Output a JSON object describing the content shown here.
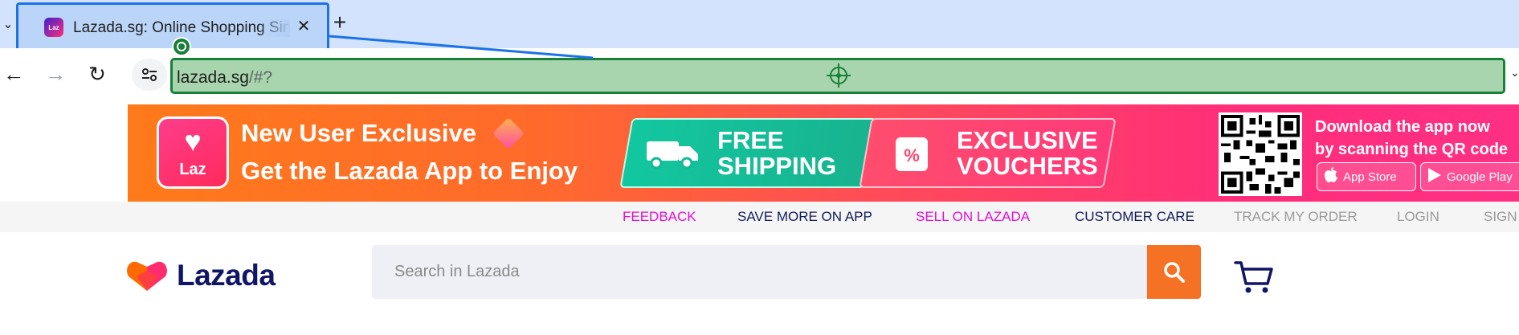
{
  "browser": {
    "tab": {
      "title": "Lazada.sg: Online Shopping Singapore",
      "favicon_icon": "lazada-favicon-icon"
    },
    "address_bar": {
      "host": "lazada.sg",
      "path": "/#?"
    },
    "icons": {
      "tab_list": "chevron-down-icon",
      "close": "close-icon",
      "new_tab": "plus-icon",
      "back": "arrow-left-icon",
      "forward": "arrow-right-icon",
      "reload": "reload-icon",
      "site_info": "tune-icon"
    }
  },
  "promo": {
    "line1": "New User Exclusive",
    "line2": "Get the Lazada App to Enjoy",
    "logo_label": "Laz",
    "free_shipping": [
      "FREE",
      "SHIPPING"
    ],
    "exclusive_vouchers": [
      "EXCLUSIVE",
      "VOUCHERS"
    ],
    "download_text": [
      "Download the app now",
      "by scanning the QR code"
    ],
    "app_store": "App Store",
    "google_play": "Google Play"
  },
  "topnav": {
    "feedback": "FEEDBACK",
    "save_more": "SAVE MORE ON APP",
    "sell": "SELL ON LAZADA",
    "customer_care": "CUSTOMER CARE",
    "track_order": "TRACK MY ORDER",
    "login": "LOGIN",
    "signup": "SIGN"
  },
  "header": {
    "logo_text": "Lazada",
    "search_placeholder": "Search in Lazada"
  },
  "colors": {
    "brand_orange": "#f57224",
    "brand_navy": "#101566",
    "nav_pink": "#e30fd3",
    "highlight_green": "#188038",
    "highlight_blue": "#1a73e8"
  }
}
